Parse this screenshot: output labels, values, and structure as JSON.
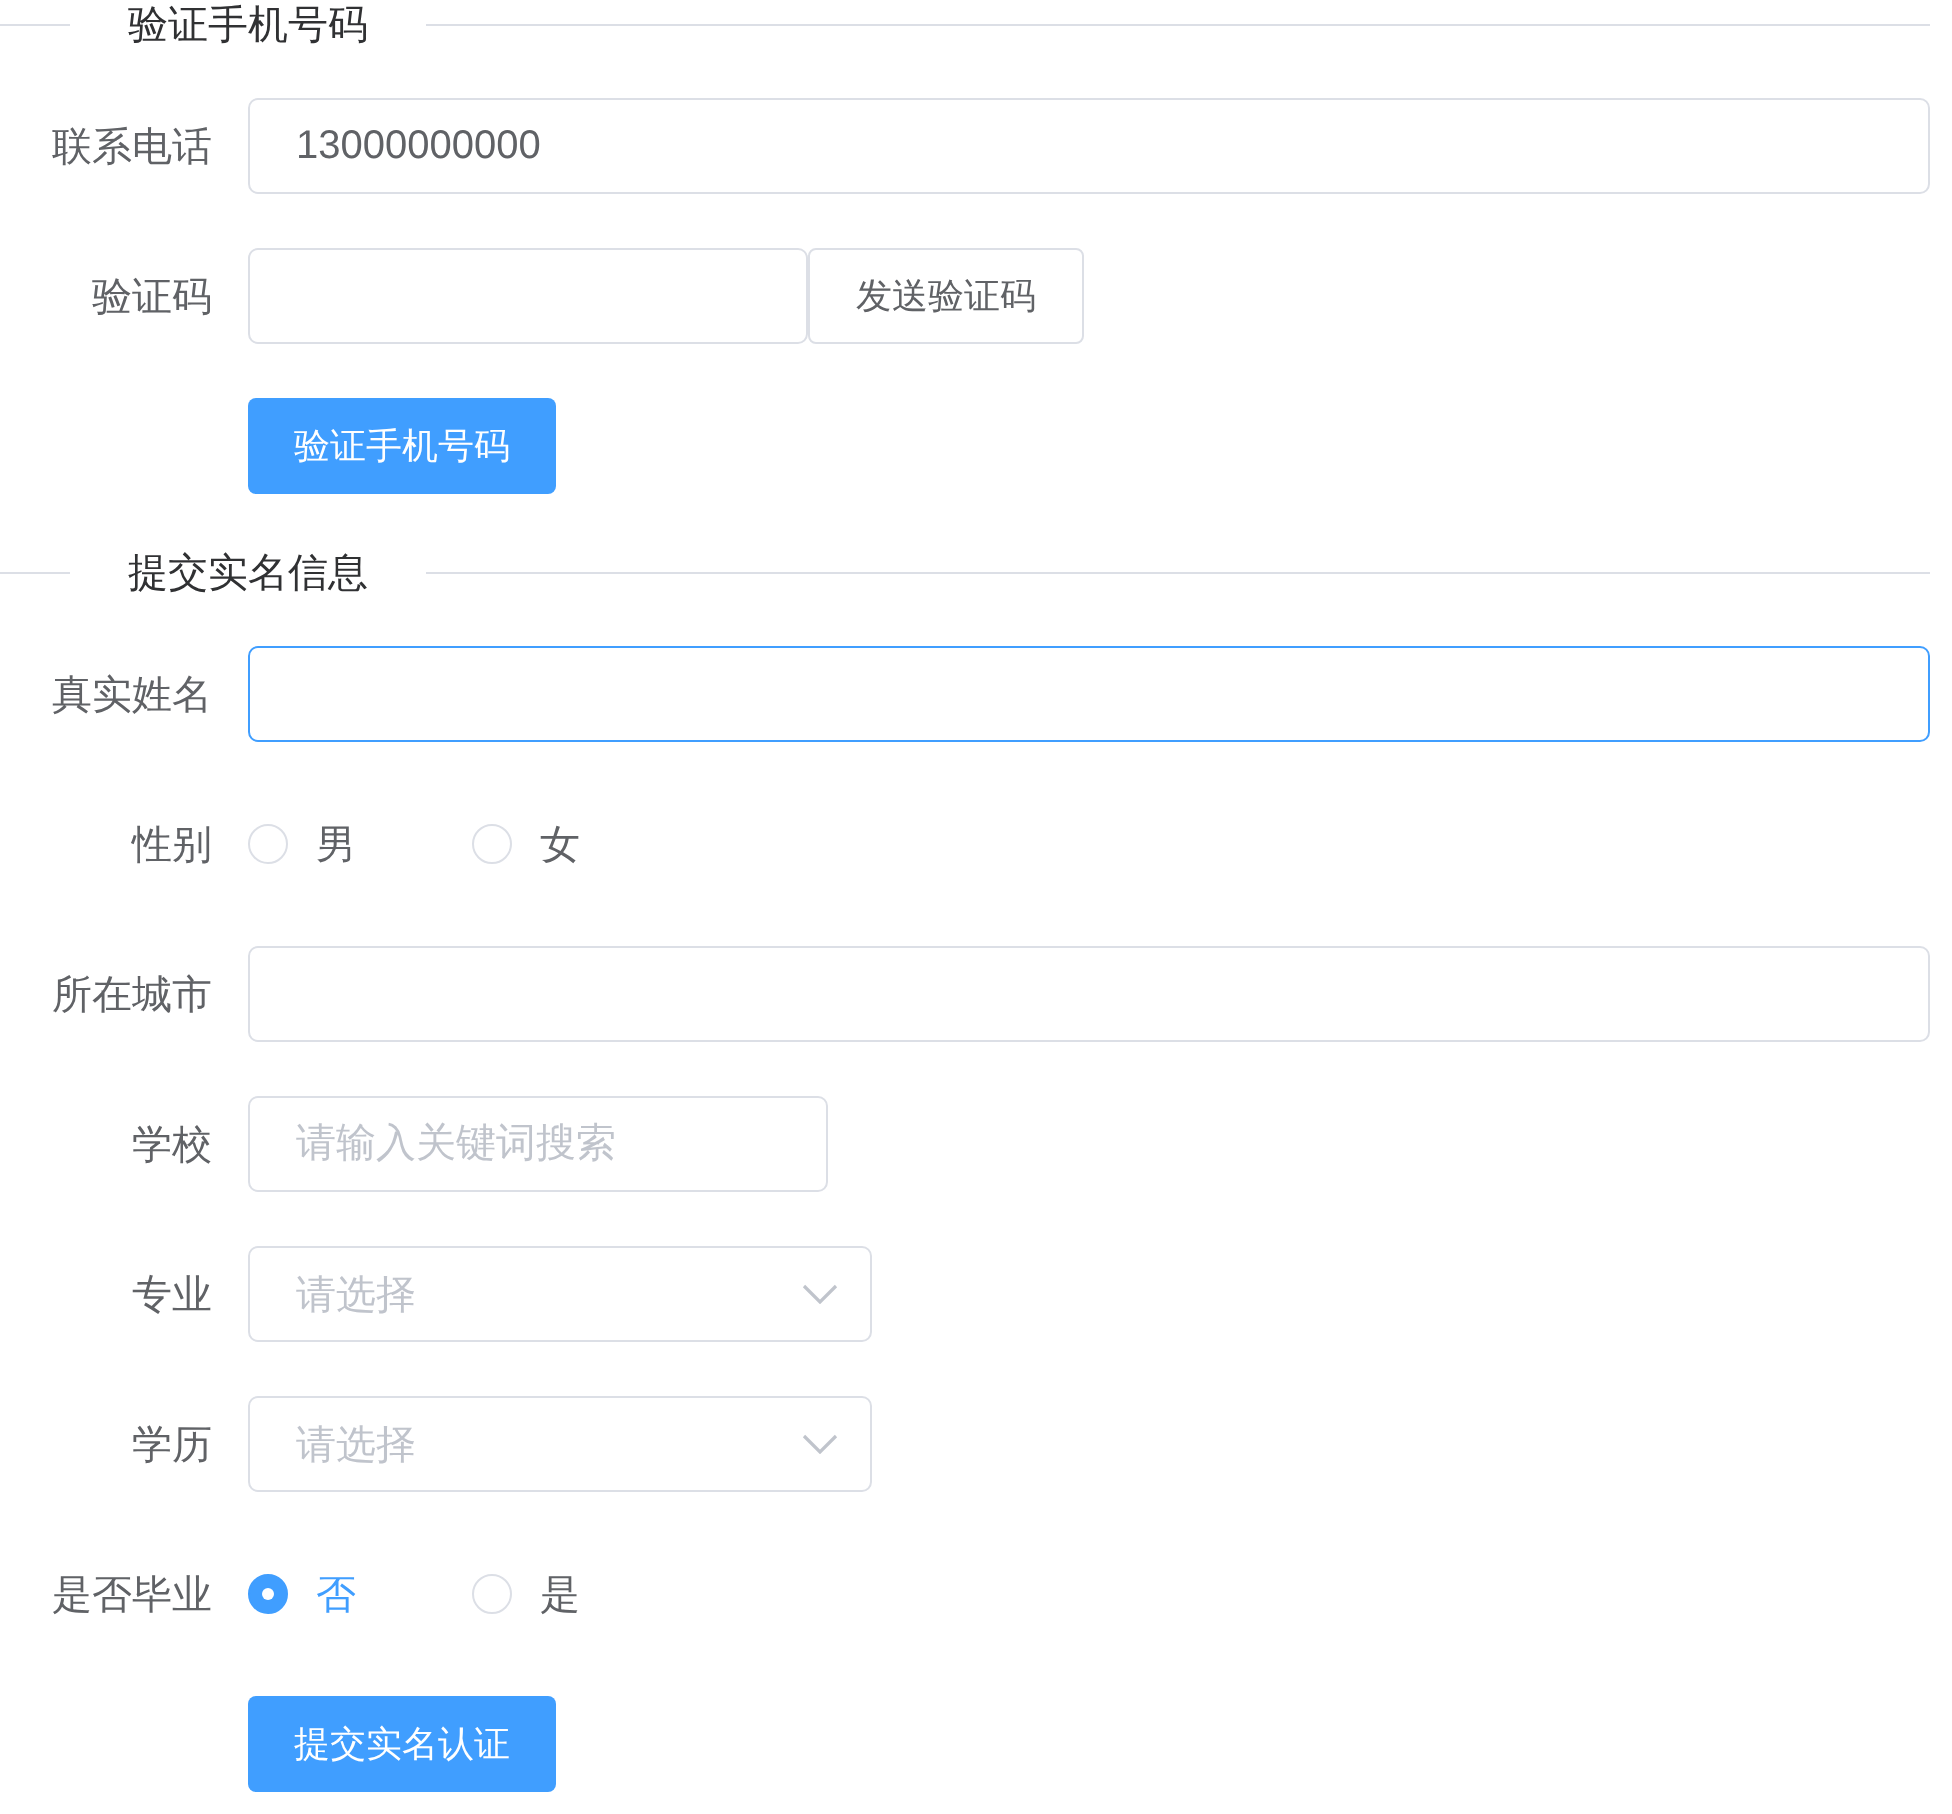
{
  "sections": [
    {
      "title": "验证手机号码",
      "fields": [
        {
          "kind": "input",
          "label": "联系电话",
          "value": "13000000000",
          "focused": false
        },
        {
          "kind": "input_button",
          "label": "验证码",
          "button": "发送验证码"
        },
        {
          "kind": "button",
          "button": "验证手机号码"
        }
      ]
    },
    {
      "title": "提交实名信息",
      "fields": [
        {
          "kind": "input",
          "label": "真实姓名",
          "focused": true
        },
        {
          "kind": "radio",
          "label": "性别",
          "options": [
            {
              "label": "男",
              "selected": false
            },
            {
              "label": "女",
              "selected": false
            }
          ]
        },
        {
          "kind": "input",
          "label": "所在城市",
          "focused": false
        },
        {
          "kind": "short_input",
          "label": "学校",
          "placeholder": "请输入关键词搜索"
        },
        {
          "kind": "select",
          "label": "专业",
          "placeholder": "请选择"
        },
        {
          "kind": "select",
          "label": "学历",
          "placeholder": "请选择"
        },
        {
          "kind": "radio",
          "label": "是否毕业",
          "options": [
            {
              "label": "否",
              "selected": true
            },
            {
              "label": "是",
              "selected": false
            }
          ]
        },
        {
          "kind": "button",
          "button": "提交实名认证"
        }
      ]
    }
  ]
}
